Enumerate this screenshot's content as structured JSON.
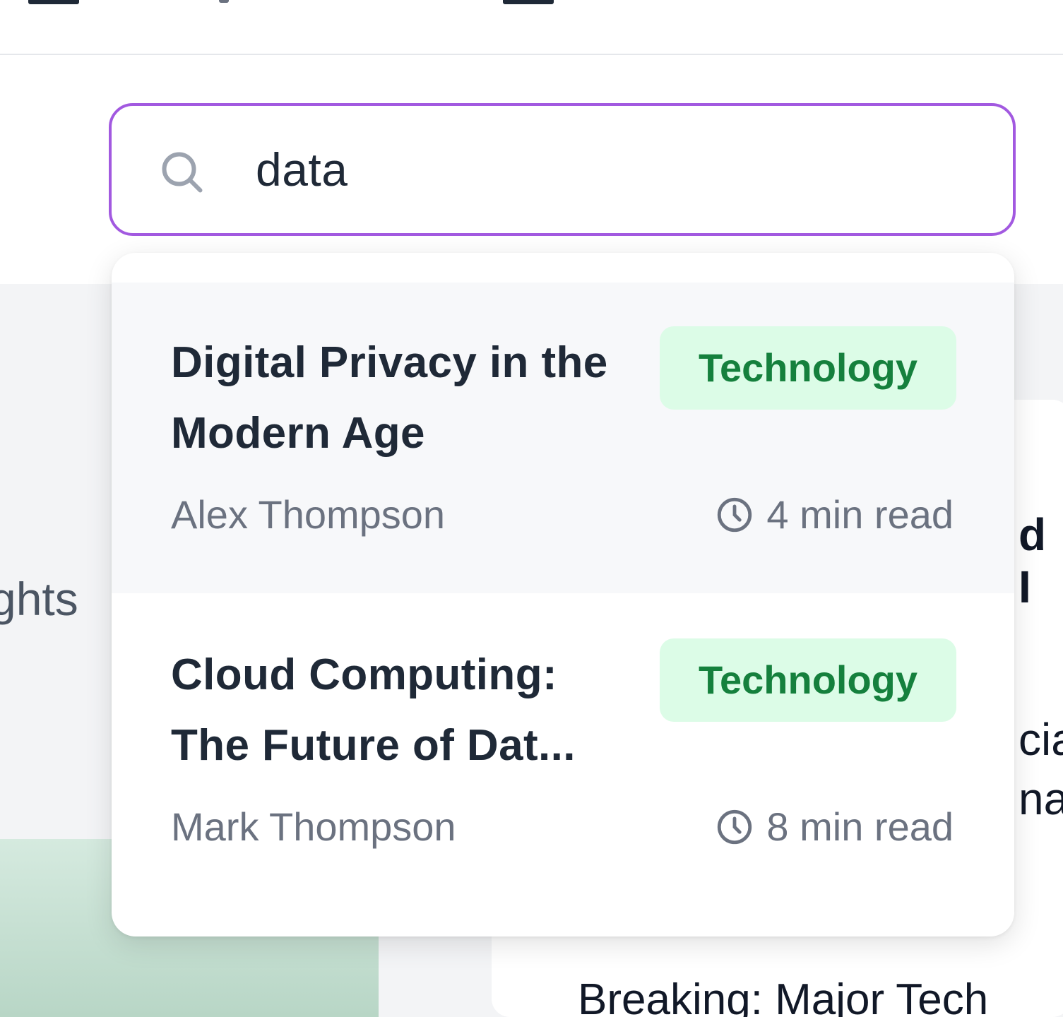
{
  "search": {
    "value": "data"
  },
  "background": {
    "left_fragment": "ghts",
    "right_fragments": [
      "d I",
      "cia",
      "na"
    ],
    "headline_fragment": "Breaking: Major Tech"
  },
  "results": [
    {
      "title": "Digital Privacy in the Modern Age",
      "category": "Technology",
      "author": "Alex Thompson",
      "read_time": "4 min read",
      "highlighted": true
    },
    {
      "title": "Cloud Computing: The Future of Dat...",
      "category": "Technology",
      "author": "Mark Thompson",
      "read_time": "8 min read",
      "highlighted": false
    }
  ],
  "colors": {
    "accent": "#a259e0",
    "badge_bg": "#dcfce7",
    "badge_text": "#15803d"
  },
  "icons": [
    "search-icon",
    "clock-icon"
  ]
}
